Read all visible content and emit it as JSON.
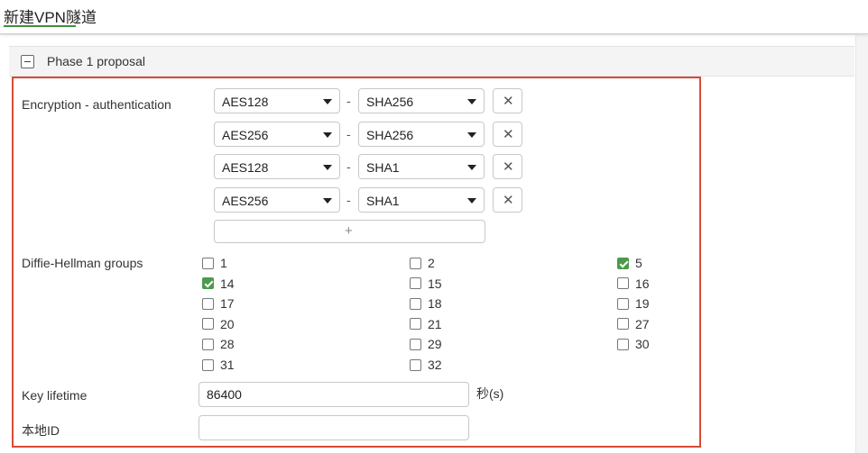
{
  "header": {
    "title": "新建VPN隧道"
  },
  "section": {
    "title": "Phase 1 proposal"
  },
  "encryption": {
    "label": "Encryption - authentication",
    "separator": "-",
    "remove_symbol": "✕",
    "add_symbol": "+",
    "rows": [
      {
        "encryption": "AES128",
        "authentication": "SHA256"
      },
      {
        "encryption": "AES256",
        "authentication": "SHA256"
      },
      {
        "encryption": "AES128",
        "authentication": "SHA1"
      },
      {
        "encryption": "AES256",
        "authentication": "SHA1"
      }
    ]
  },
  "dh": {
    "label": "Diffie-Hellman groups",
    "groups": [
      {
        "label": "1",
        "checked": false
      },
      {
        "label": "2",
        "checked": false
      },
      {
        "label": "5",
        "checked": true
      },
      {
        "label": "14",
        "checked": true
      },
      {
        "label": "15",
        "checked": false
      },
      {
        "label": "16",
        "checked": false
      },
      {
        "label": "17",
        "checked": false
      },
      {
        "label": "18",
        "checked": false
      },
      {
        "label": "19",
        "checked": false
      },
      {
        "label": "20",
        "checked": false
      },
      {
        "label": "21",
        "checked": false
      },
      {
        "label": "27",
        "checked": false
      },
      {
        "label": "28",
        "checked": false
      },
      {
        "label": "29",
        "checked": false
      },
      {
        "label": "30",
        "checked": false
      },
      {
        "label": "31",
        "checked": false
      },
      {
        "label": "32",
        "checked": false
      }
    ]
  },
  "key_lifetime": {
    "label": "Key lifetime",
    "value": "86400",
    "unit": "秒(s)"
  },
  "local_id": {
    "label": "本地ID",
    "value": ""
  },
  "colors": {
    "accent": "#3f8f3f",
    "highlight": "#d94a35",
    "checkbox_checked": "#4c9a4c"
  }
}
